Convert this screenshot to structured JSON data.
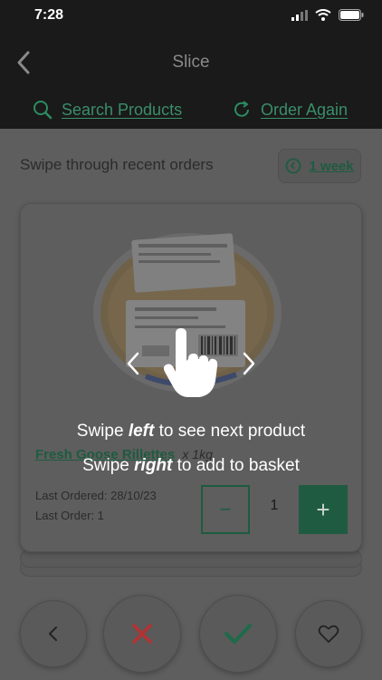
{
  "status_bar": {
    "time": "7:28"
  },
  "nav": {
    "title": "Slice"
  },
  "tabs": {
    "search_label": "Search Products",
    "order_again_label": "Order Again"
  },
  "header": {
    "subtitle": "Swipe through recent orders",
    "period_label": "1 week"
  },
  "product": {
    "name": "Fresh Goose Rillettes",
    "size": "x 1kg",
    "last_ordered": "Last Ordered: 28/10/23",
    "last_order": "Last Order: 1",
    "quantity": "1",
    "minus_label": "−",
    "plus_label": "+"
  },
  "overlay": {
    "line1_prefix": "Swipe ",
    "line1_em": "left",
    "line1_suffix": " to see next product",
    "line2_prefix": "Swipe ",
    "line2_em": "right",
    "line2_suffix": " to add to basket"
  },
  "colors": {
    "brand_green": "#1f5b41",
    "reject_red": "#b43232",
    "accept_green": "#1e6b4a"
  }
}
